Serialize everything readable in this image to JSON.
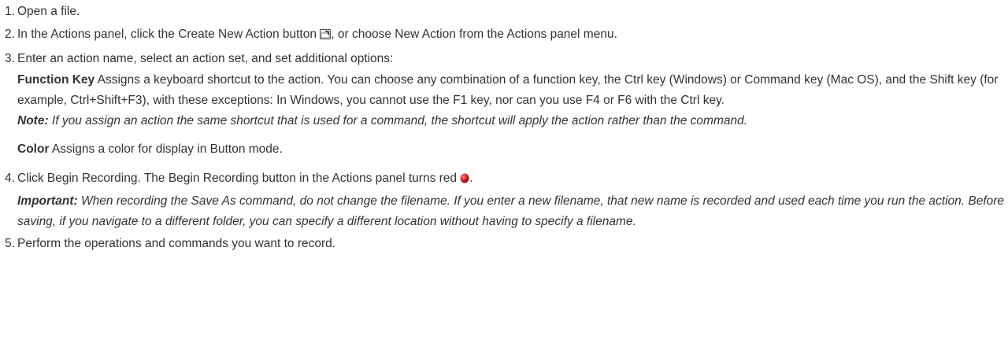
{
  "steps": [
    {
      "number": "1.",
      "text": "Open a file."
    },
    {
      "number": "2.",
      "text_before": "In the Actions panel, click the Create New Action button",
      "icon": "create-new-action-icon",
      "text_after": ", or choose New Action from the Actions panel menu."
    },
    {
      "number": "3.",
      "text": "Enter an action name, select an action set, and set additional options:",
      "definitions": [
        {
          "term": "Function Key",
          "description": " Assigns a keyboard shortcut to the action. You can choose any combination of a function key, the Ctrl key (Windows) or Command key (Mac OS), and the Shift key (for example, Ctrl+Shift+F3), with these exceptions: In Windows, you cannot use the F1 key, nor can you use F4 or F6 with the Ctrl key."
        }
      ],
      "note": {
        "label": "Note:",
        "text": "  If you assign an action the same shortcut that is used for a command, the shortcut will apply the action rather than the command."
      },
      "definition2": {
        "term": "Color",
        "description": " Assigns a color for display in Button mode."
      }
    },
    {
      "number": "4.",
      "text": "Click Begin Recording. The Begin Recording button in the Actions panel turns red",
      "icon": "record-dot-icon",
      "text_after": ".",
      "important": {
        "label": "Important:",
        "text": "  When recording the Save As command, do not change the filename. If you enter a new filename, that new name is recorded and used each time you run the action. Before saving, if you navigate to a different folder, you can specify a different location without having to specify a filename."
      }
    },
    {
      "number": "5.",
      "text": "Perform the operations and commands you want to record."
    }
  ],
  "colors": {
    "text": "#333333",
    "record_red": "#cc2020"
  }
}
